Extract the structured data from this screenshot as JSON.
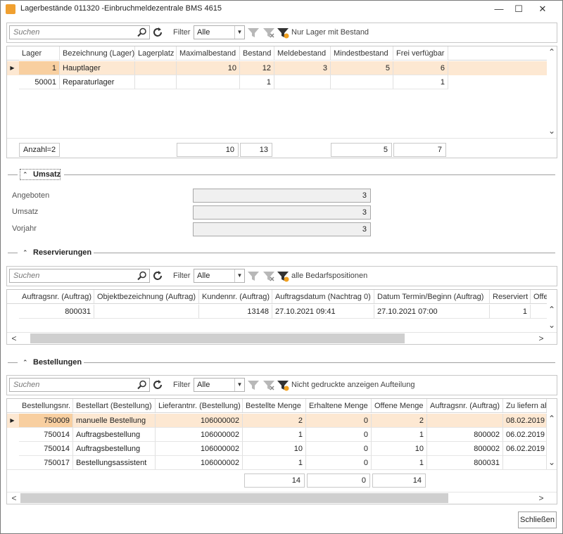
{
  "window": {
    "title": "Lagerbestände 011320 -Einbruchmeldezentrale BMS 4615"
  },
  "icons": {
    "app": "app-icon",
    "minimize": "minimize-icon",
    "maximize": "maximize-icon",
    "close": "close-icon",
    "search": "search-icon",
    "refresh": "refresh-icon",
    "filter": "filter-icon",
    "filter_clear": "filter-clear-icon",
    "filter_active": "filter-active-icon",
    "collapse": "chevron-up-icon",
    "row_pointer": "row-pointer-icon",
    "scroll_left": "scroll-left-icon",
    "scroll_right": "scroll-right-icon",
    "scroll_down": "scroll-down-icon",
    "scroll_up": "scroll-up-icon"
  },
  "glyphs": {
    "minimize": "—",
    "maximize": "☐",
    "close": "✕",
    "chevron": "⌃",
    "down": "⌄",
    "up": "⌃",
    "pointer": "▶",
    "left": "<",
    "right": ">",
    "combo": "▼"
  },
  "colors": {
    "selected_row": "#fde8d2",
    "selected_key": "#f8cfa0",
    "filter_accent": "#f0a020"
  },
  "lager": {
    "search_placeholder": "Suchen",
    "filter_label": "Filter",
    "filter_value": "Alle",
    "filter_option": "Nur Lager mit Bestand",
    "columns": [
      "Lager",
      "Bezeichnung (Lager)",
      "Lagerplatz",
      "Maximalbestand",
      "Bestand",
      "Meldebestand",
      "Mindestbestand",
      "Frei verfügbar"
    ],
    "rows": [
      {
        "lager": "1",
        "bez": "Hauptlager",
        "platz": "",
        "max": "10",
        "bestand": "12",
        "melde": "3",
        "mindest": "5",
        "frei": "6"
      },
      {
        "lager": "50001",
        "bez": "Reparaturlager",
        "platz": "",
        "max": "",
        "bestand": "1",
        "melde": "",
        "mindest": "",
        "frei": "1"
      }
    ],
    "summary": {
      "count": "Anzahl=2",
      "max": "10",
      "bestand": "13",
      "mindest": "5",
      "frei": "7"
    }
  },
  "umsatz": {
    "title": "Umsatz",
    "fields": [
      {
        "label": "Angeboten",
        "value": "3"
      },
      {
        "label": "Umsatz",
        "value": "3"
      },
      {
        "label": "Vorjahr",
        "value": "3"
      }
    ]
  },
  "reserv": {
    "title": "Reservierungen",
    "search_placeholder": "Suchen",
    "filter_label": "Filter",
    "filter_value": "Alle",
    "filter_option": "alle Bedarfspositionen",
    "columns": [
      "Auftragsnr. (Auftrag)",
      "Objektbezeichnung (Auftrag)",
      "Kundennr. (Auftrag)",
      "Auftragsdatum (Nachtrag 0)",
      "Datum Termin/Beginn (Auftrag)",
      "Reserviert",
      "Offe"
    ],
    "rows": [
      {
        "auftrag": "800031",
        "objekt": "",
        "kunde": "13148",
        "datum": "27.10.2021 09:41",
        "termin": "27.10.2021 07:00",
        "res": "1",
        "offen": ""
      }
    ],
    "scroll_fraction": 0.74
  },
  "bestell": {
    "title": "Bestellungen",
    "search_placeholder": "Suchen",
    "filter_label": "Filter",
    "filter_value": "Alle",
    "filter_option": "Nicht gedruckte anzeigen Aufteilung",
    "columns": [
      "Bestellungsnr.",
      "Bestellart (Bestellung)",
      "Lieferantnr. (Bestellung)",
      "Bestellte Menge",
      "Erhaltene Menge",
      "Offene Menge",
      "Auftragsnr. (Auftrag)",
      "Zu liefern ab"
    ],
    "rows": [
      {
        "nr": "750009",
        "art": "manuelle Bestellung",
        "lief": "106000002",
        "best": "2",
        "erh": "0",
        "off": "2",
        "auftrag": "",
        "ab": "08.02.2019"
      },
      {
        "nr": "750014",
        "art": "Auftragsbestellung",
        "lief": "106000002",
        "best": "1",
        "erh": "0",
        "off": "1",
        "auftrag": "800002",
        "ab": "06.02.2019"
      },
      {
        "nr": "750014",
        "art": "Auftragsbestellung",
        "lief": "106000002",
        "best": "10",
        "erh": "0",
        "off": "10",
        "auftrag": "800002",
        "ab": "06.02.2019"
      },
      {
        "nr": "750017",
        "art": "Bestellungsassistent",
        "lief": "106000002",
        "best": "1",
        "erh": "0",
        "off": "1",
        "auftrag": "800031",
        "ab": ""
      }
    ],
    "summary": {
      "best": "14",
      "erh": "0",
      "off": "14"
    },
    "scroll_fraction": 0.83
  },
  "footer": {
    "close_label": "Schließen"
  }
}
